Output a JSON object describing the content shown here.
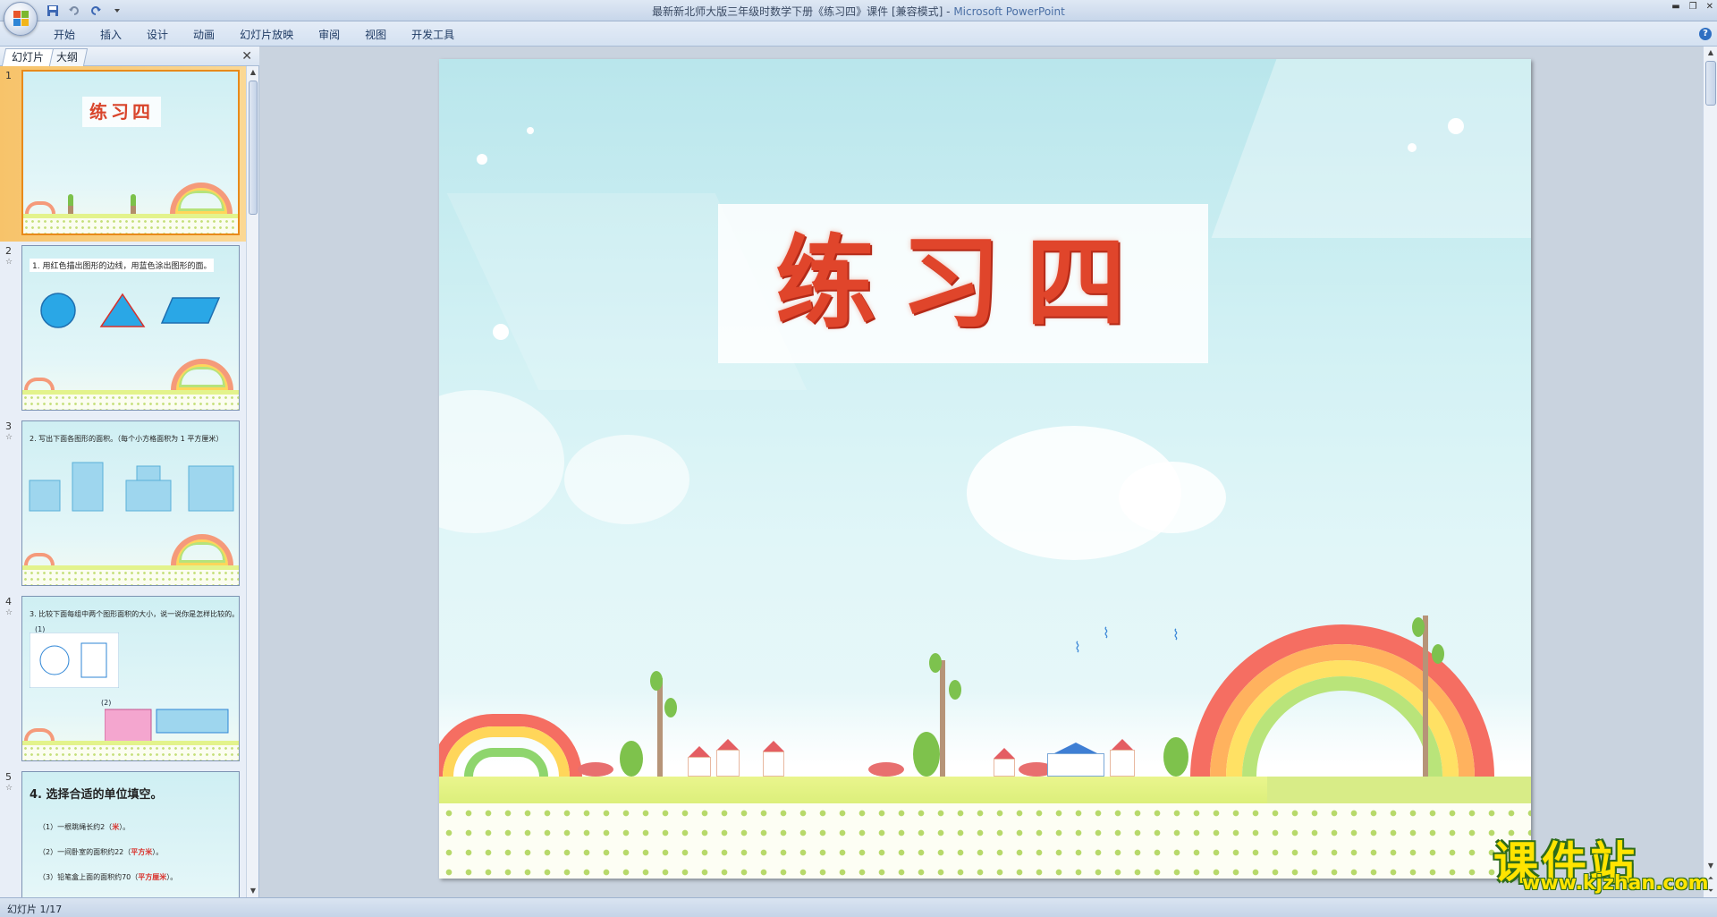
{
  "window": {
    "title_doc": "最新新北师大版三年级时数学下册《练习四》课件 [兼容模式] - ",
    "title_app": "Microsoft PowerPoint"
  },
  "ribbon": {
    "tabs": [
      "开始",
      "插入",
      "设计",
      "动画",
      "幻灯片放映",
      "审阅",
      "视图",
      "开发工具"
    ],
    "help": "?"
  },
  "pane": {
    "tab_slides": "幻灯片",
    "tab_outline": "大纲",
    "close": "✕"
  },
  "thumbnails": [
    {
      "num": "1",
      "title": "练习四"
    },
    {
      "num": "2",
      "caption": "1. 用红色描出图形的边线，用蓝色涂出图形的面。"
    },
    {
      "num": "3",
      "caption": "2. 写出下面各图形的面积。（每个小方格面积为 1 平方厘米）"
    },
    {
      "num": "4",
      "caption": "3. 比较下面每组中两个图形面积的大小，说一说你是怎样比较的。",
      "sub1": "(1)",
      "sub2": "(2)"
    },
    {
      "num": "5",
      "caption": "4. 选择合适的单位填空。",
      "line1": "（1）一根跳绳长约2（",
      "ans1": "米",
      "line1b": "）。",
      "line2": "（2）一间卧室的面积约22（",
      "ans2": "平方米",
      "line2b": "）。",
      "line3": "（3）铅笔盒上面的面积约70（",
      "ans3": "平方厘米",
      "line3b": "）。"
    }
  ],
  "slide": {
    "title": "练习四"
  },
  "watermark": {
    "text": "课件站",
    "url": "www.kjzhan.com"
  },
  "status": {
    "slide_info": "幻灯片 1/17"
  }
}
